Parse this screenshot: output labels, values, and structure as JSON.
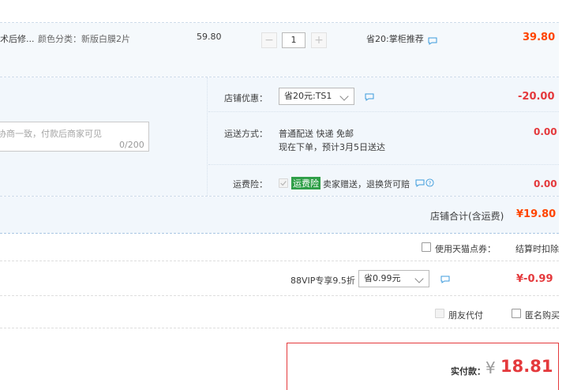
{
  "item": {
    "title_fragment": "术后修...",
    "sku": "颜色分类：新版白膜2片",
    "unit_price": "59.80",
    "quantity": "1",
    "promo": "省20:掌柜推荐",
    "subtotal": "39.80"
  },
  "shop": {
    "coupon_label": "店铺优惠：",
    "coupon_value": "省20元:TS1",
    "coupon_amount": "-20.00",
    "message_placeholder": "协商一致，付款后商家可见",
    "message_counter": "0/200",
    "shipping_label": "运送方式：",
    "shipping_line1": "普通配送 快递 免邮",
    "shipping_line2": "现在下单，预计3月5日送达",
    "shipping_amount": "0.00",
    "insurance_label": "运费险：",
    "insurance_badge": "运费险",
    "insurance_text": "卖家赠送，退换货可赔",
    "insurance_amount": "0.00",
    "total_label": "店铺合计(含运费)",
    "total_amount": "¥19.80"
  },
  "tmall_points": {
    "label": "使用天猫点券：",
    "note": "结算时扣除"
  },
  "vip": {
    "label": "88VIP专享9.5折",
    "select_value": "省0.99元",
    "amount": "¥-0.99"
  },
  "options": {
    "friend_pay": "朋友代付",
    "anonymous": "匿名购买"
  },
  "payment": {
    "label": "实付款：",
    "currency": "¥",
    "amount": "18.81"
  },
  "colors": {
    "accent_red": "#e4393c",
    "badge_green": "#2f9f48",
    "link_blue": "#3c9bdc"
  }
}
